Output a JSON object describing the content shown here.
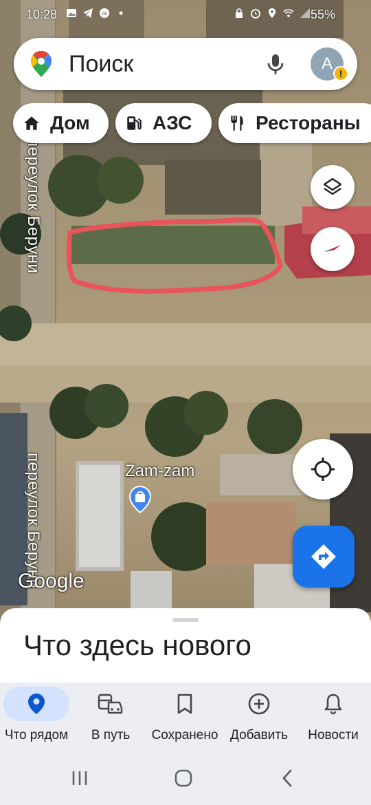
{
  "status_bar": {
    "time": "10:28",
    "battery": "55%"
  },
  "search": {
    "placeholder": "Поиск"
  },
  "account": {
    "initial": "A",
    "warning": "!"
  },
  "chips": [
    {
      "label": "Дом",
      "icon": "home-icon"
    },
    {
      "label": "АЗС",
      "icon": "gas-station-icon"
    },
    {
      "label": "Рестораны",
      "icon": "restaurant-icon"
    }
  ],
  "map": {
    "streets": [
      "переулок Беруни",
      "переулок Беруни"
    ],
    "place": {
      "name": "Zam-zam",
      "icon": "shopping-bag-pin-icon"
    },
    "attribution": "Google",
    "highlight_color": "#e8545a"
  },
  "bottom_sheet": {
    "title": "Что здесь нового"
  },
  "bottom_nav": [
    {
      "label": "Что рядом",
      "icon": "location-pin-icon",
      "active": true
    },
    {
      "label": "В путь",
      "icon": "commute-icon",
      "active": false
    },
    {
      "label": "Сохранено",
      "icon": "bookmark-icon",
      "active": false
    },
    {
      "label": "Добавить",
      "icon": "add-circle-icon",
      "active": false
    },
    {
      "label": "Новости",
      "icon": "bell-icon",
      "active": false
    }
  ],
  "colors": {
    "accent": "#1a73e8",
    "active_nav_bg": "#d3e3fd",
    "nav_bg": "#eceef3"
  }
}
